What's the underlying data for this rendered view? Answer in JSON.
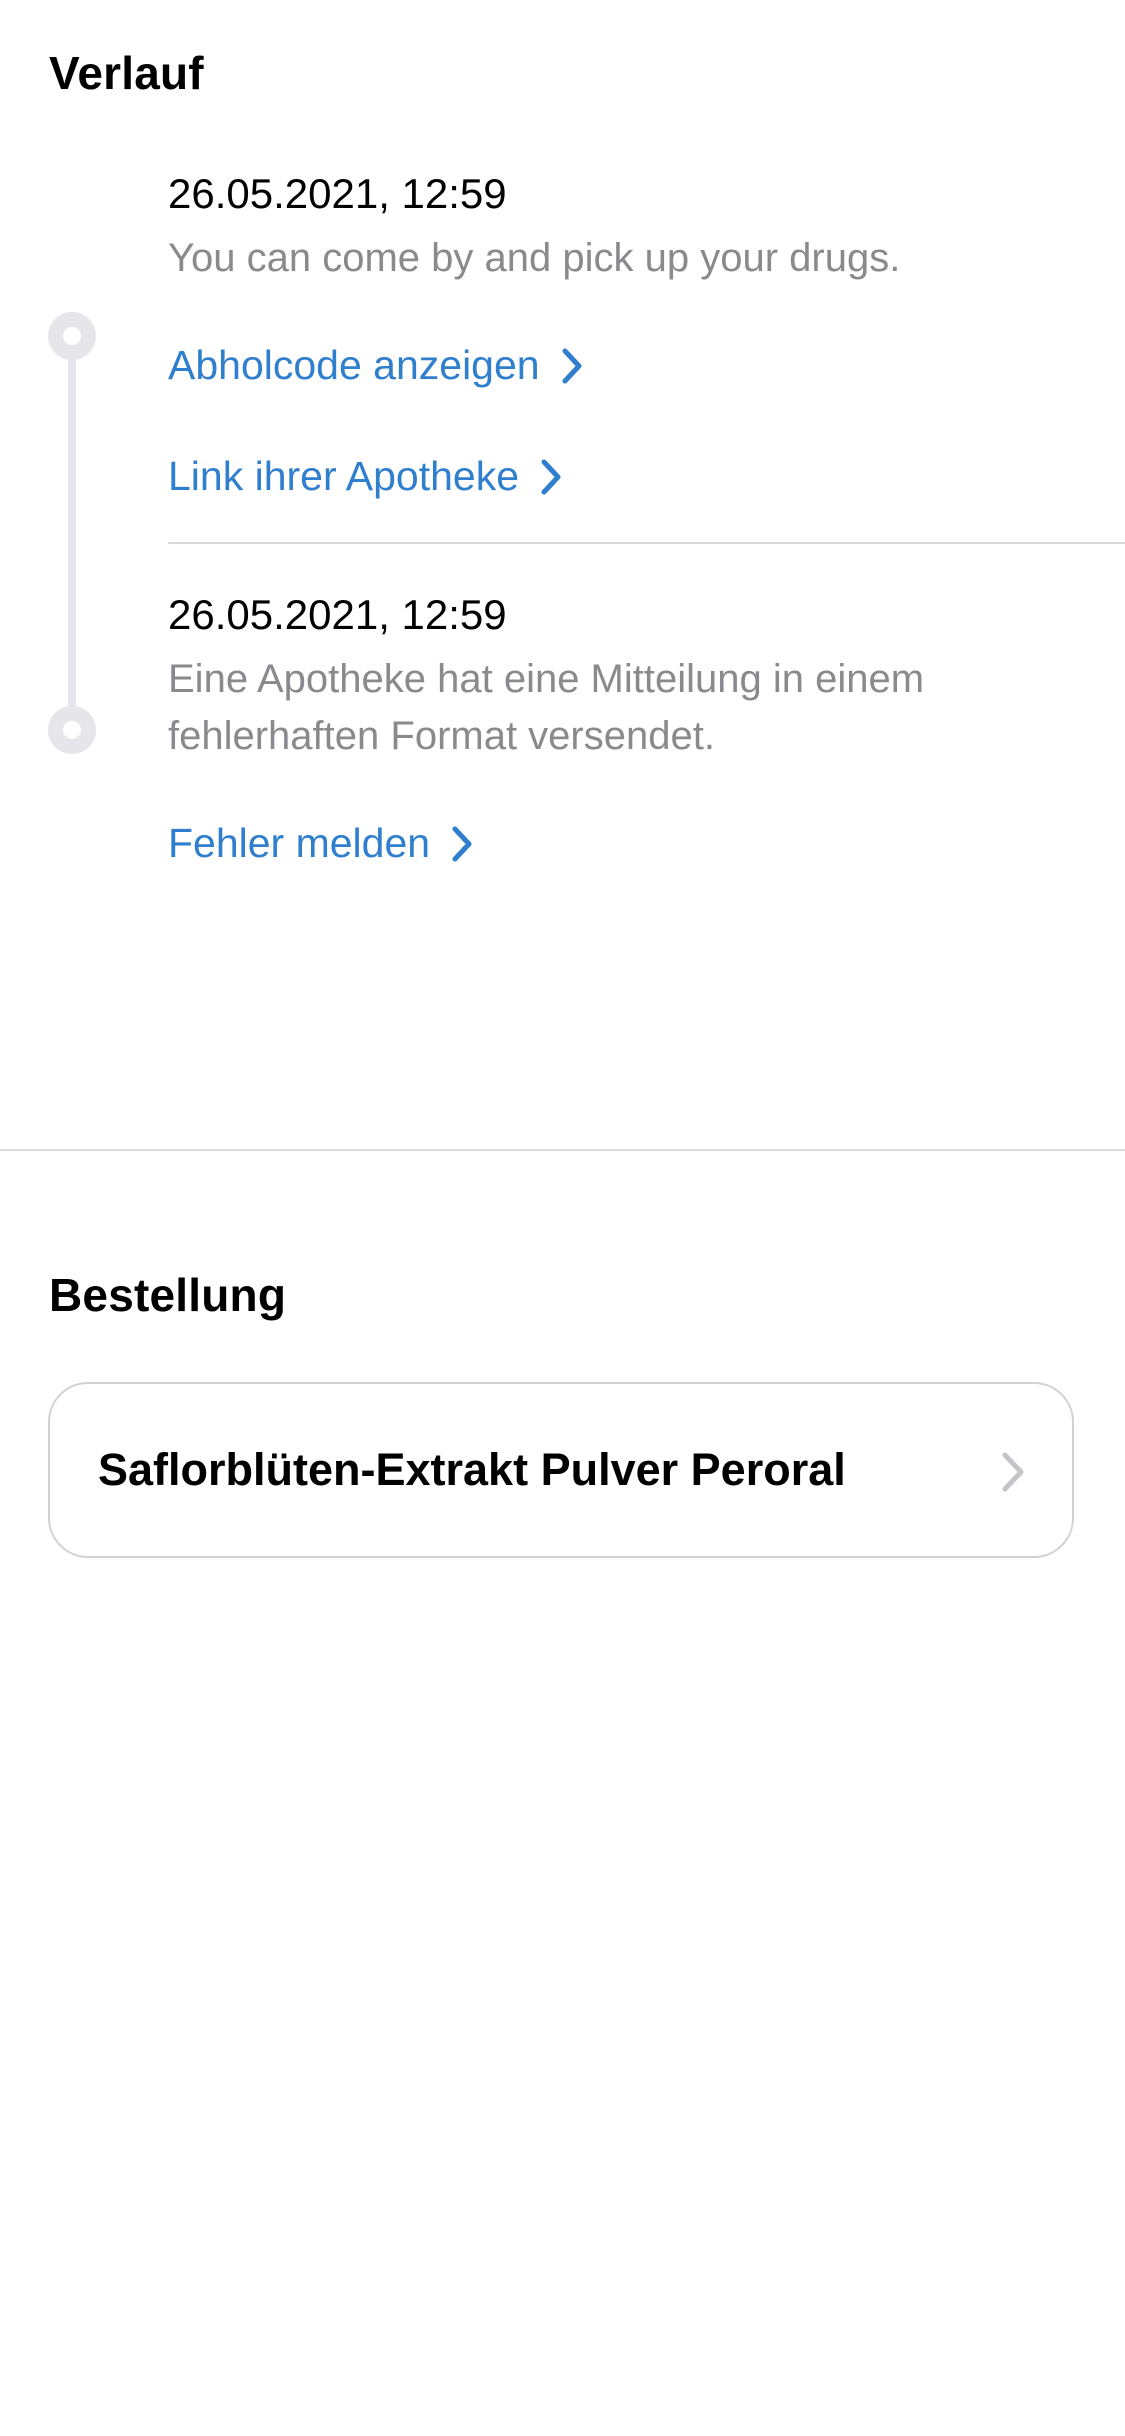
{
  "history": {
    "title": "Verlauf",
    "entries": [
      {
        "date": "26.05.2021, 12:59",
        "message": "You can come by and pick up your drugs.",
        "links": [
          "Abholcode anzeigen",
          "Link ihrer Apotheke"
        ]
      },
      {
        "date": "26.05.2021, 12:59",
        "message": "Eine Apotheke hat eine Mitteilung in einem fehlerhaften Format versendet.",
        "links": [
          "Fehler melden"
        ]
      }
    ]
  },
  "order": {
    "title": "Bestellung",
    "items": [
      {
        "name": "Saflorblüten-Extrakt Pulver Peroral"
      }
    ]
  },
  "colors": {
    "link": "#2f7fce",
    "secondary_text": "#8a8a8e",
    "timeline": "#e5e5ea",
    "divider": "#d9d9de"
  },
  "icons": {
    "link_chevron": "chevron-right-icon",
    "order_chevron": "chevron-right-icon",
    "timeline_marker": "timeline-dot-icon"
  }
}
